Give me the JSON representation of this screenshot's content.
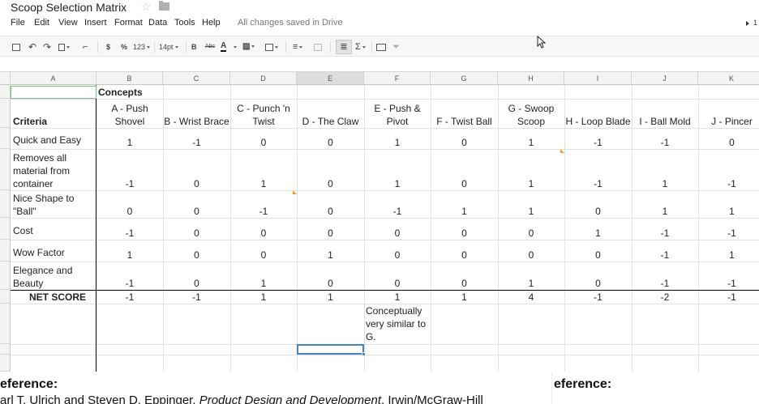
{
  "doc": {
    "title": "Scoop Selection Matrix",
    "save_status": "All changes saved in Drive",
    "right_indicator": "1"
  },
  "menu": [
    "File",
    "Edit",
    "View",
    "Insert",
    "Format",
    "Data",
    "Tools",
    "Help"
  ],
  "toolbar": {
    "currency": "$",
    "percent": "%",
    "number_format": "123",
    "font_size": "14pt",
    "bold": "B",
    "strikethrough": "Abc",
    "text_color": "A",
    "sigma": "Σ"
  },
  "columns": [
    "A",
    "B",
    "C",
    "D",
    "E",
    "F",
    "G",
    "H",
    "I",
    "J",
    "K"
  ],
  "sheet": {
    "concepts_label": "Concepts",
    "criteria_label": "Criteria",
    "net_score_label": "NET SCORE",
    "concept_names": [
      "A - Push Shovel",
      "B - Wrist Brace",
      "C - Punch 'n Twist",
      "D - The Claw",
      "E - Push & Pivot",
      "F - Twist Ball",
      "G - Swoop Scoop",
      "H - Loop Blade",
      "I - Ball Mold",
      "J - Pincer"
    ],
    "rows": [
      {
        "criterion": "Quick and Easy",
        "scores": [
          "1",
          "-1",
          "0",
          "0",
          "1",
          "0",
          "1",
          "-1",
          "-1",
          "0"
        ]
      },
      {
        "criterion": "Removes all material from container",
        "scores": [
          "-1",
          "0",
          "1",
          "0",
          "1",
          "0",
          "1",
          "-1",
          "1",
          "-1"
        ]
      },
      {
        "criterion": "Nice Shape to \"Ball\"",
        "scores": [
          "0",
          "0",
          "-1",
          "0",
          "-1",
          "1",
          "1",
          "0",
          "1",
          "1"
        ]
      },
      {
        "criterion": "Cost",
        "scores": [
          "-1",
          "0",
          "0",
          "0",
          "0",
          "0",
          "0",
          "1",
          "-1",
          "-1"
        ]
      },
      {
        "criterion": "Wow Factor",
        "scores": [
          "1",
          "0",
          "0",
          "1",
          "0",
          "0",
          "0",
          "0",
          "-1",
          "1"
        ]
      },
      {
        "criterion": "Elegance and Beauty",
        "scores": [
          "-1",
          "0",
          "1",
          "0",
          "0",
          "0",
          "1",
          "0",
          "-1",
          "-1"
        ]
      }
    ],
    "net_scores": [
      "-1",
      "-1",
      "1",
      "1",
      "1",
      "1",
      "4",
      "-1",
      "-2",
      "-1"
    ],
    "note": "Conceptually very similar to G."
  },
  "reference": {
    "heading": "eference:",
    "text_plain": "arl T. Ulrich and Steven D. Eppinger, ",
    "text_italic": "Product Design and Development",
    "text_tail": ", Irwin/McGraw-Hill",
    "right_heading": "eference:"
  },
  "colors": {
    "selection_blue": "#4a7fd4",
    "selection_green": "#7cbf7c",
    "note_orange": "#f0a020"
  }
}
